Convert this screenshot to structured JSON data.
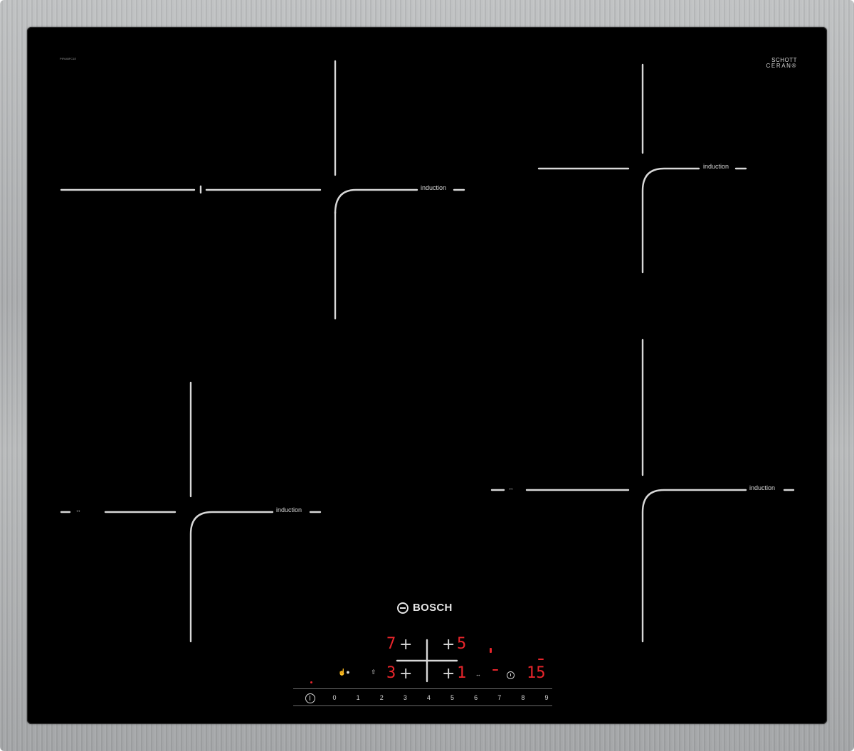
{
  "model_code": "PIF645FC1E",
  "glass_brand": {
    "line1": "SCHOTT",
    "line2": "CERAN®"
  },
  "zone_label": "induction",
  "flex_label": "↔",
  "brand": "BOSCH",
  "displays": {
    "top_left_level": "7",
    "top_right_level": "5",
    "bottom_left_level": "3",
    "bottom_right_level": "1",
    "timer_value": "15"
  },
  "slider_steps": [
    "0",
    "1",
    "2",
    "3",
    "4",
    "5",
    "6",
    "7",
    "8",
    "9"
  ],
  "colors": {
    "frame": "#b0b2b4",
    "glass": "#000000",
    "print": "#d8d8d8",
    "led": "#e8252b"
  },
  "icons": [
    "power-icon",
    "childlock-icon",
    "boost-icon",
    "flex-icon",
    "clock-icon",
    "plus-icon"
  ]
}
